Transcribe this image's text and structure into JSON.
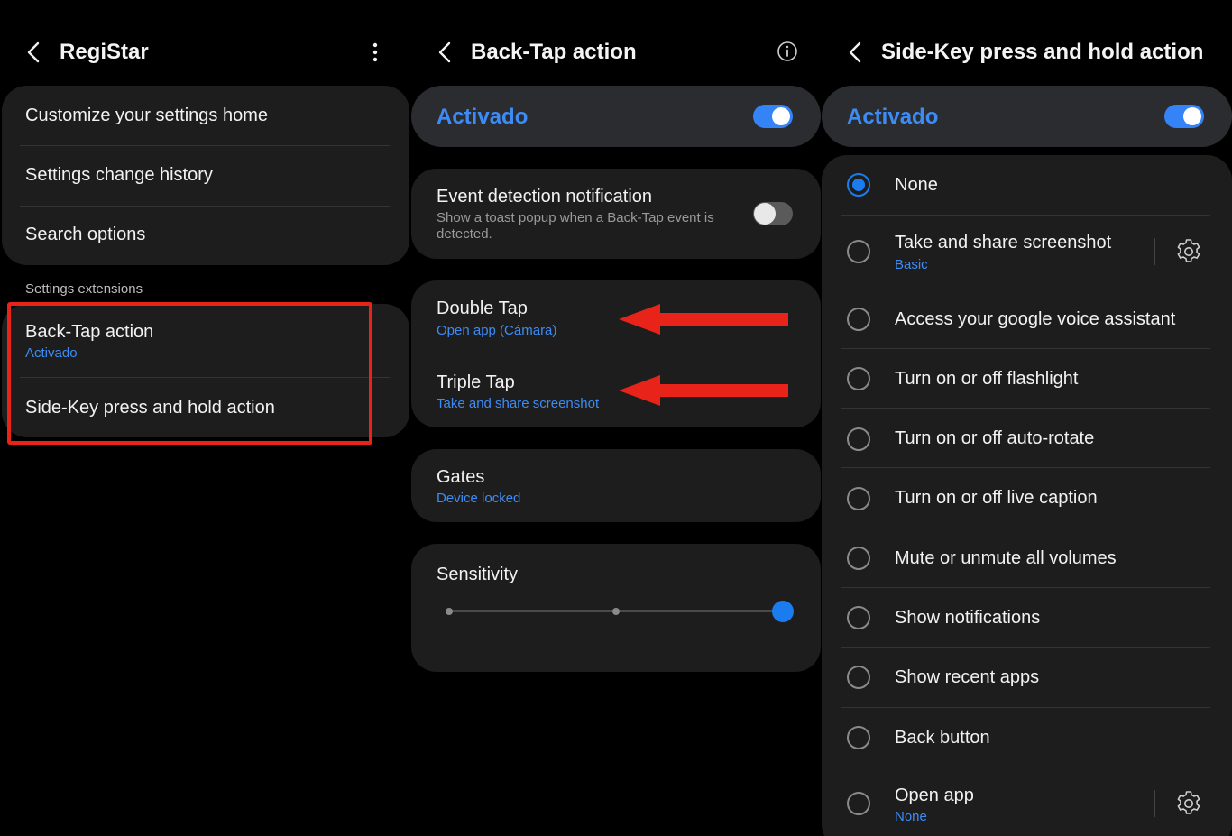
{
  "panel1": {
    "title": "RegiStar",
    "menu_items": [
      {
        "label": "Customize your settings home"
      },
      {
        "label": "Settings change history"
      },
      {
        "label": "Search options"
      }
    ],
    "section_label": "Settings extensions",
    "extensions": [
      {
        "label": "Back-Tap action",
        "sub": "Activado"
      },
      {
        "label": "Side-Key press and hold action"
      }
    ],
    "highlight_color": "#e8231a"
  },
  "panel2": {
    "title": "Back-Tap action",
    "master": {
      "label": "Activado",
      "on": true
    },
    "event_detection": {
      "label": "Event detection notification",
      "sub": "Show a toast popup when a Back-Tap event is detected.",
      "on": false
    },
    "double_tap": {
      "label": "Double Tap",
      "sub": "Open app (Cámara)"
    },
    "triple_tap": {
      "label": "Triple Tap",
      "sub": "Take and share screenshot"
    },
    "gates": {
      "label": "Gates",
      "sub": "Device locked"
    },
    "sensitivity": {
      "label": "Sensitivity",
      "level_fraction": 1.0,
      "steps": 3
    }
  },
  "panel3": {
    "title": "Side-Key press and hold action",
    "master": {
      "label": "Activado",
      "on": true
    },
    "options": [
      {
        "label": "None",
        "selected": true
      },
      {
        "label": "Take and share screenshot",
        "sub": "Basic",
        "has_settings": true
      },
      {
        "label": "Access your google voice assistant"
      },
      {
        "label": "Turn on or off flashlight"
      },
      {
        "label": "Turn on or off auto-rotate"
      },
      {
        "label": "Turn on or off live caption"
      },
      {
        "label": "Mute or unmute all volumes"
      },
      {
        "label": "Show notifications"
      },
      {
        "label": "Show recent apps"
      },
      {
        "label": "Back button"
      },
      {
        "label": "Open app",
        "sub": "None",
        "has_settings": true
      }
    ]
  },
  "colors": {
    "accent": "#3584f7",
    "link": "#3d8cf5",
    "annotation_red": "#e8231a",
    "card": "#1d1d1d",
    "background": "#000000"
  }
}
